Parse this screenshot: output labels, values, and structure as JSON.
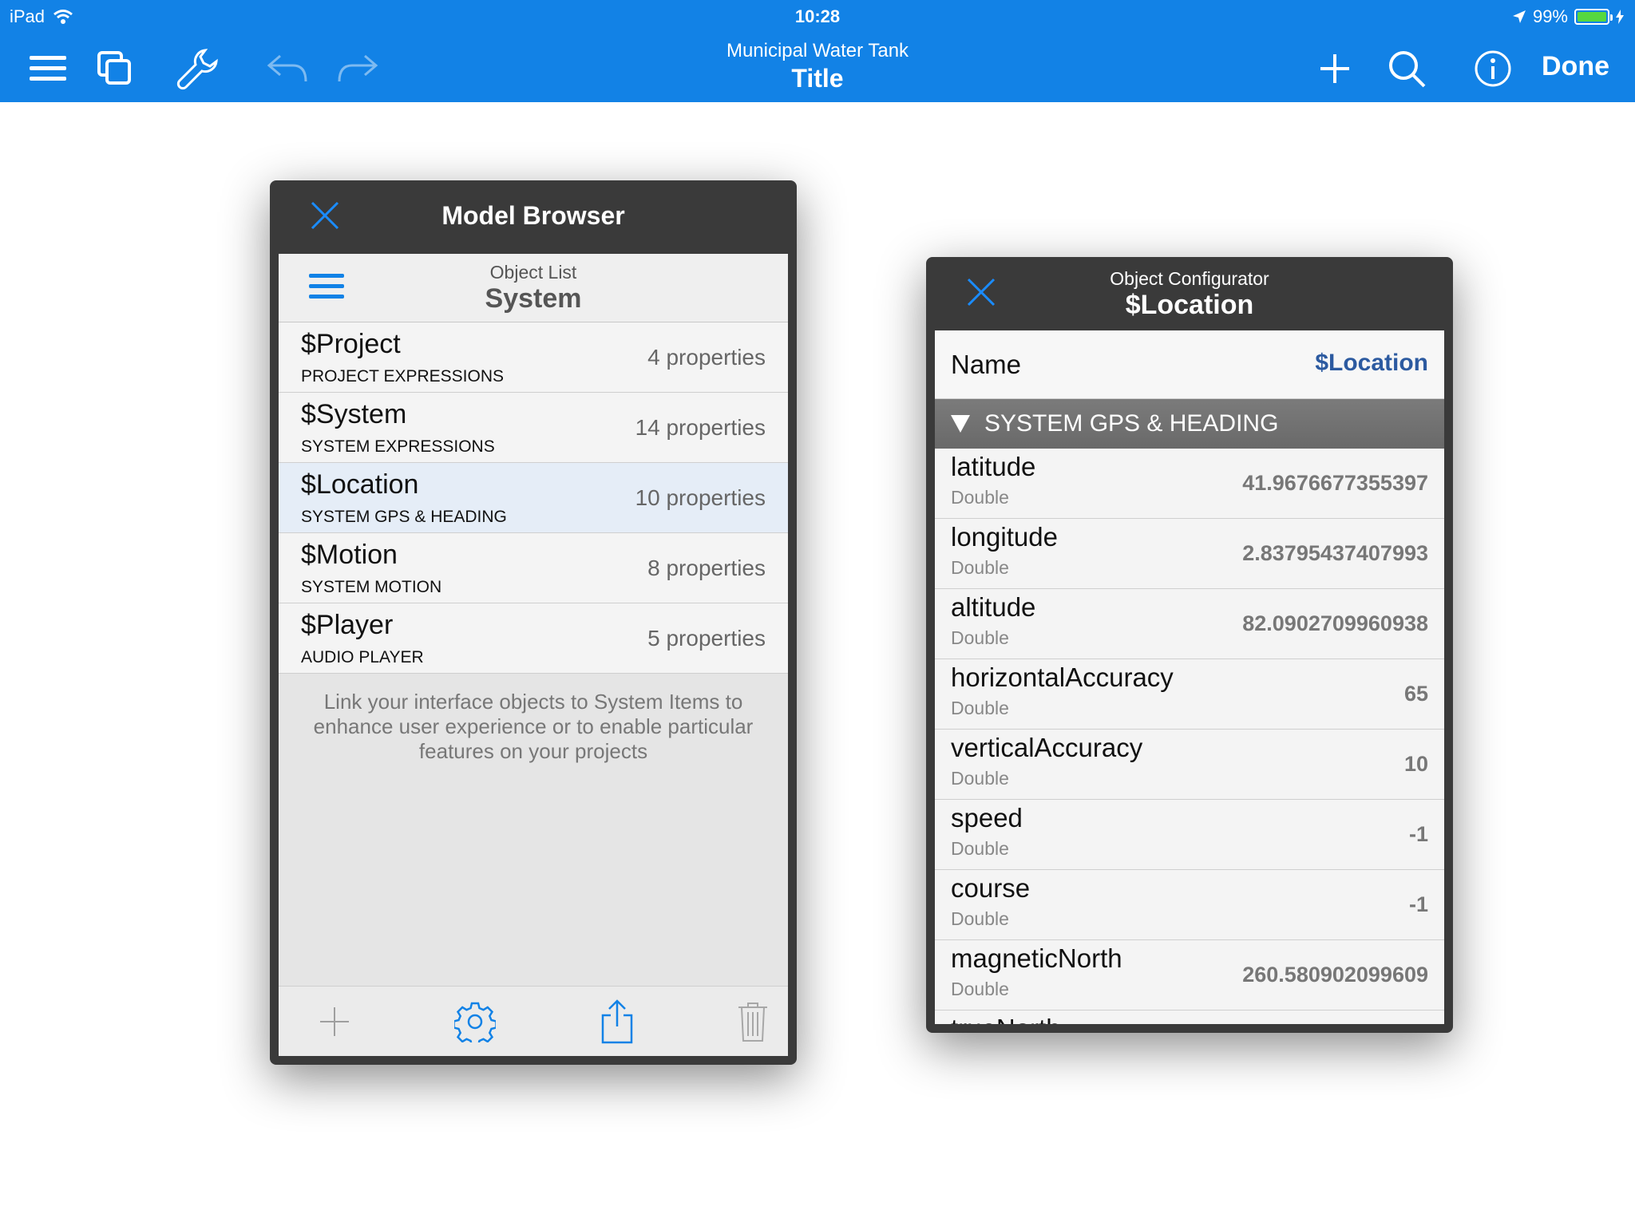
{
  "status_bar": {
    "carrier": "iPad",
    "time": "10:28",
    "battery": "99%",
    "battery_level": 0.99
  },
  "nav": {
    "subtitle": "Municipal Water Tank",
    "title": "Title",
    "done_label": "Done",
    "icons": [
      "menu-icon",
      "copy-icon",
      "wrench-icon",
      "undo-icon",
      "redo-icon",
      "plus-icon",
      "search-icon",
      "info-icon"
    ]
  },
  "model_browser": {
    "title": "Model Browser",
    "list_subtitle": "Object List",
    "list_title": "System",
    "items": [
      {
        "name": "$Project",
        "desc": "PROJECT EXPRESSIONS",
        "count": "4 properties"
      },
      {
        "name": "$System",
        "desc": "SYSTEM EXPRESSIONS",
        "count": "14 properties"
      },
      {
        "name": "$Location",
        "desc": "SYSTEM GPS & HEADING",
        "count": "10 properties",
        "selected": true
      },
      {
        "name": "$Motion",
        "desc": "SYSTEM MOTION",
        "count": "8 properties"
      },
      {
        "name": "$Player",
        "desc": "AUDIO PLAYER",
        "count": "5 properties"
      }
    ],
    "hint": "Link your interface objects to System Items to enhance user experience or to enable particular features on your projects",
    "toolbar": [
      "plus-icon",
      "gear-icon",
      "share-icon",
      "trash-icon"
    ]
  },
  "object_configurator": {
    "subtitle": "Object Configurator",
    "title": "$Location",
    "name_label": "Name",
    "name_value": "$Location",
    "section": "SYSTEM GPS & HEADING",
    "properties": [
      {
        "name": "latitude",
        "type": "Double",
        "value": "41.9676677355397"
      },
      {
        "name": "longitude",
        "type": "Double",
        "value": "2.83795437407993"
      },
      {
        "name": "altitude",
        "type": "Double",
        "value": "82.0902709960938"
      },
      {
        "name": "horizontalAccuracy",
        "type": "Double",
        "value": "65"
      },
      {
        "name": "verticalAccuracy",
        "type": "Double",
        "value": "10"
      },
      {
        "name": "speed",
        "type": "Double",
        "value": "-1"
      },
      {
        "name": "course",
        "type": "Double",
        "value": "-1"
      },
      {
        "name": "magneticNorth",
        "type": "Double",
        "value": "260.580902099609"
      },
      {
        "name": "trueNorth",
        "type": "",
        "value": ""
      }
    ]
  },
  "colors": {
    "accent": "#1282e6",
    "panel": "#3a3a3a",
    "link": "#2c5aa0",
    "battery": "#56d83f"
  }
}
